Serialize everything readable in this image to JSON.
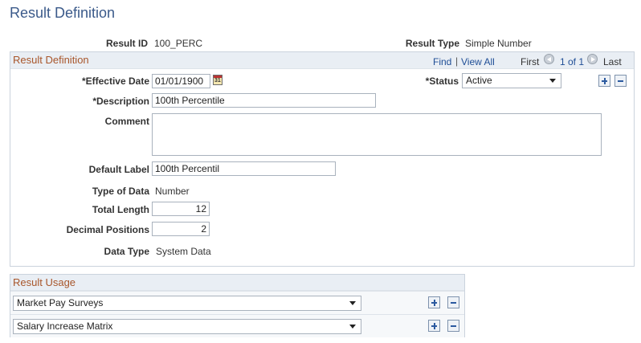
{
  "page": {
    "title": "Result Definition"
  },
  "header": {
    "result_id_label": "Result ID",
    "result_id_value": "100_PERC",
    "result_type_label": "Result Type",
    "result_type_value": "Simple Number"
  },
  "definition": {
    "group_title": "Result Definition",
    "nav": {
      "find": "Find",
      "sep": "|",
      "view_all": "View All",
      "first": "First",
      "counter": "1 of 1",
      "last": "Last"
    },
    "effective_date": {
      "label": "*Effective Date",
      "value": "01/01/1900",
      "calendar_glyph": "31"
    },
    "status": {
      "label": "*Status",
      "value": "Active"
    },
    "description": {
      "label": "*Description",
      "value": "100th Percentile"
    },
    "comment": {
      "label": "Comment",
      "value": ""
    },
    "default_label": {
      "label": "Default Label",
      "value": "100th Percentil"
    },
    "type_of_data": {
      "label": "Type of Data",
      "value": "Number"
    },
    "total_length": {
      "label": "Total Length",
      "value": "12"
    },
    "decimal_positions": {
      "label": "Decimal Positions",
      "value": "2"
    },
    "data_type": {
      "label": "Data Type",
      "value": "System Data"
    }
  },
  "usage": {
    "group_title": "Result Usage",
    "rows": [
      {
        "value": "Market Pay Surveys"
      },
      {
        "value": "Salary Increase Matrix"
      }
    ]
  },
  "icons": {
    "prev": "chevron-left-icon",
    "next": "chevron-right-icon",
    "add": "plus-icon",
    "delete": "minus-icon",
    "calendar": "calendar-icon"
  },
  "colors": {
    "title": "#3b5a8a",
    "group_title": "#a8562b",
    "link": "#1f4e96",
    "group_header_bg": "#e9eef4",
    "border": "#cbd3dd"
  }
}
